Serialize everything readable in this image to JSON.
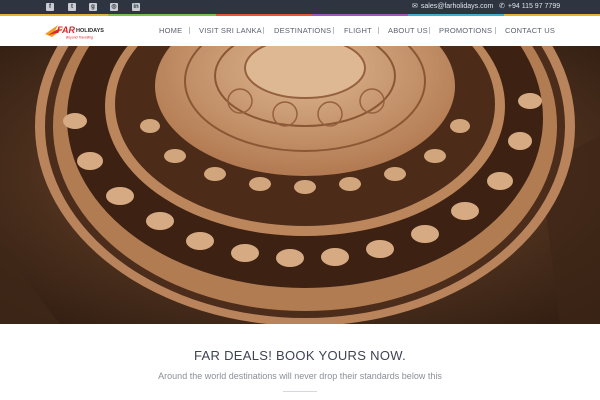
{
  "topbar": {
    "social": [
      {
        "name": "facebook-icon",
        "glyph": "f"
      },
      {
        "name": "twitter-icon",
        "glyph": "t"
      },
      {
        "name": "google-plus-icon",
        "glyph": "g"
      },
      {
        "name": "instagram-icon",
        "glyph": "◎"
      },
      {
        "name": "linkedin-icon",
        "glyph": "in"
      }
    ],
    "email": "sales@farholidays.com",
    "phone": "+94 115 97 7799"
  },
  "brand": {
    "logo_main": "FAR",
    "logo_word": "HOLIDAYS",
    "logo_tagline": "Beyond Travelling",
    "colors": {
      "red": "#d9252b",
      "orange": "#f29a21",
      "dark": "#2b2b2b"
    }
  },
  "nav": {
    "items": [
      "HOME",
      "VISIT SRI LANKA",
      "DESTINATIONS",
      "FLIGHT",
      "ABOUT US",
      "PROMOTIONS",
      "CONTACT US"
    ]
  },
  "hero": {
    "subject": "moonstone-carving",
    "colors": {
      "stone": "#c79469",
      "dark": "#3a2418",
      "light": "#e2b48a"
    }
  },
  "deals": {
    "title": "FAR DEALS! BOOK YOURS NOW.",
    "subtitle": "Around the world destinations will never drop their standards below this"
  }
}
